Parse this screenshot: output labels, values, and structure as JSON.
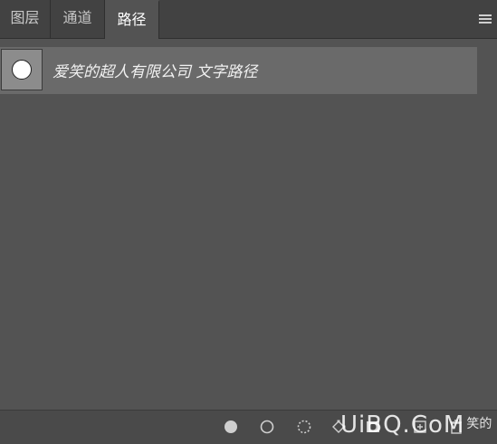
{
  "tabs": [
    {
      "label": "图层"
    },
    {
      "label": "通道"
    },
    {
      "label": "路径"
    }
  ],
  "active_tab": "路径",
  "paths": [
    {
      "name": "爱笑的超人有限公司  文字路径",
      "thumbnail": "white-circle"
    }
  ],
  "footer_icons": [
    "fill-path-icon",
    "stroke-path-icon",
    "load-as-selection-icon",
    "make-work-path-icon",
    "add-mask-icon",
    "new-path-icon",
    "delete-path-icon"
  ],
  "watermark": {
    "logo": "UiBQ.CoM",
    "small": "笑的"
  },
  "colors": {
    "panel_bg": "#535353",
    "tabbar_bg": "#424242",
    "row_selected": "#6a6a6a",
    "footer_bg": "#4a4a4a"
  }
}
